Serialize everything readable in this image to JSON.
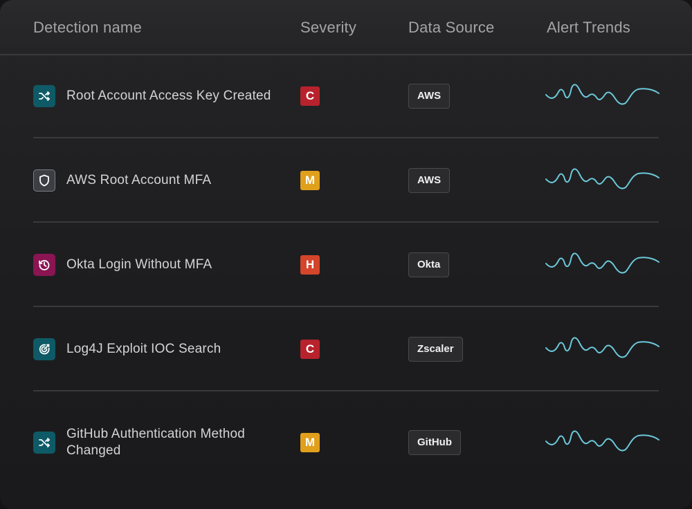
{
  "table": {
    "columns": {
      "name": "Detection name",
      "severity": "Severity",
      "source": "Data Source",
      "trend": "Alert Trends"
    },
    "rows": [
      {
        "icon": "shuffle-icon",
        "icon_color": "#0e5a66",
        "name": "Root Account Access Key Created",
        "severity": "C",
        "severity_color": "#b8222c",
        "source": "AWS"
      },
      {
        "icon": "shield-icon",
        "icon_color": "#3d3d44",
        "name": "AWS Root Account MFA",
        "severity": "M",
        "severity_color": "#e0a01c",
        "source": "AWS"
      },
      {
        "icon": "history-icon",
        "icon_color": "#8a1552",
        "name": "Okta Login Without MFA",
        "severity": "H",
        "severity_color": "#d4452b",
        "source": "Okta"
      },
      {
        "icon": "target-icon",
        "icon_color": "#0e5a66",
        "name": "Log4J Exploit IOC Search",
        "severity": "C",
        "severity_color": "#b8222c",
        "source": "Zscaler"
      },
      {
        "icon": "shuffle-icon",
        "icon_color": "#0e5a66",
        "name": "GitHub Authentication Method Changed",
        "severity": "M",
        "severity_color": "#e0a01c",
        "source": "GitHub"
      }
    ]
  },
  "colors": {
    "trend_line": "#6cc9da",
    "background": "#1d1d1f"
  }
}
